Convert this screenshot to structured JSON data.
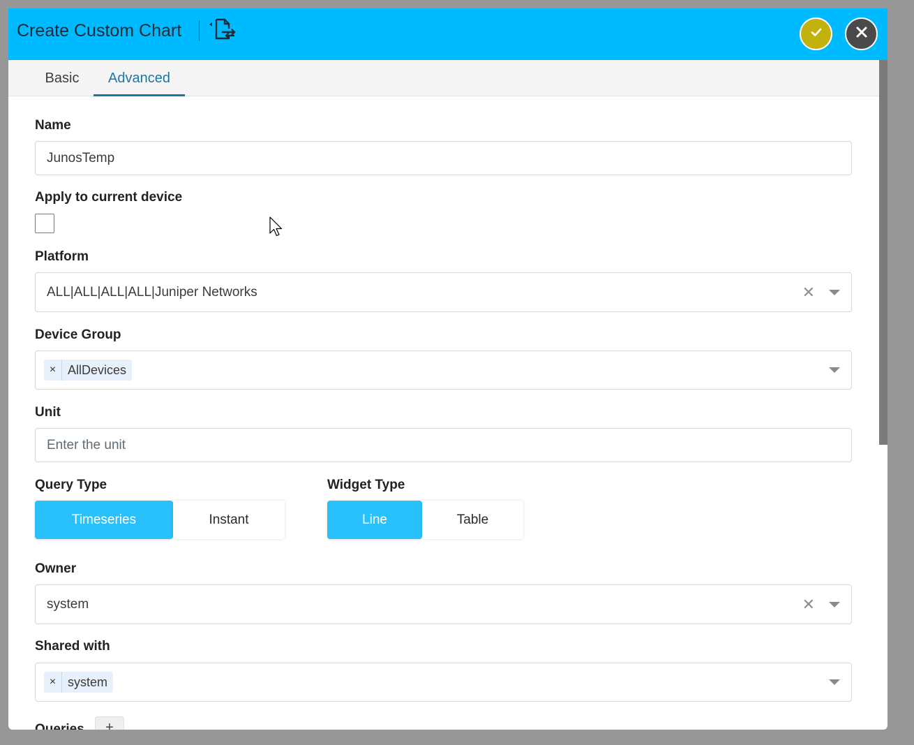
{
  "header": {
    "title": "Create Custom Chart",
    "export_icon": "export-icon",
    "confirm_icon": "check-icon",
    "close_icon": "close-icon",
    "confirm_color": "#c2b20e",
    "close_color": "#4a4a4a",
    "bg_color": "#00baff"
  },
  "tabs": [
    {
      "label": "Basic",
      "active": false
    },
    {
      "label": "Advanced",
      "active": true
    }
  ],
  "form": {
    "name": {
      "label": "Name",
      "value": "JunosTemp"
    },
    "apply_current_device": {
      "label": "Apply to current device",
      "checked": false
    },
    "platform": {
      "label": "Platform",
      "value": "ALL|ALL|ALL|ALL|Juniper Networks",
      "clear_glyph": "✕"
    },
    "device_group": {
      "label": "Device Group",
      "chips": [
        "AllDevices"
      ],
      "chip_remove_glyph": "×"
    },
    "unit": {
      "label": "Unit",
      "placeholder": "Enter the unit"
    },
    "query_type": {
      "label": "Query Type",
      "options": [
        "Timeseries",
        "Instant"
      ],
      "selected": "Timeseries"
    },
    "widget_type": {
      "label": "Widget Type",
      "options": [
        "Line",
        "Table"
      ],
      "selected": "Line"
    },
    "owner": {
      "label": "Owner",
      "value": "system",
      "clear_glyph": "✕"
    },
    "shared_with": {
      "label": "Shared with",
      "chips": [
        "system"
      ],
      "chip_remove_glyph": "×"
    },
    "queries": {
      "label": "Queries",
      "add_glyph": "+"
    }
  }
}
